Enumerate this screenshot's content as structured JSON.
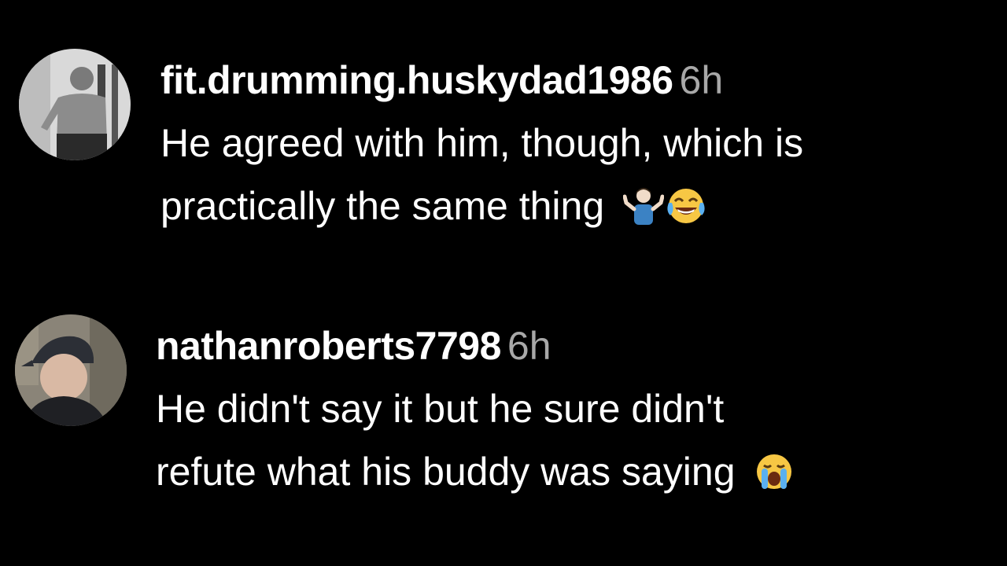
{
  "comments": [
    {
      "username": "fit.drumming.huskydad1986",
      "time": "6h",
      "lines": [
        "He agreed with him, though, which is",
        "practically the same thing"
      ],
      "emojis": [
        "person-shrugging-emoji",
        "face-with-tears-of-joy-emoji"
      ]
    },
    {
      "username": "nathanroberts7798",
      "time": "6h",
      "lines": [
        "He didn't say it but he sure didn't",
        "refute what his buddy was saying"
      ],
      "emojis": [
        "loudly-crying-face-emoji"
      ]
    }
  ]
}
